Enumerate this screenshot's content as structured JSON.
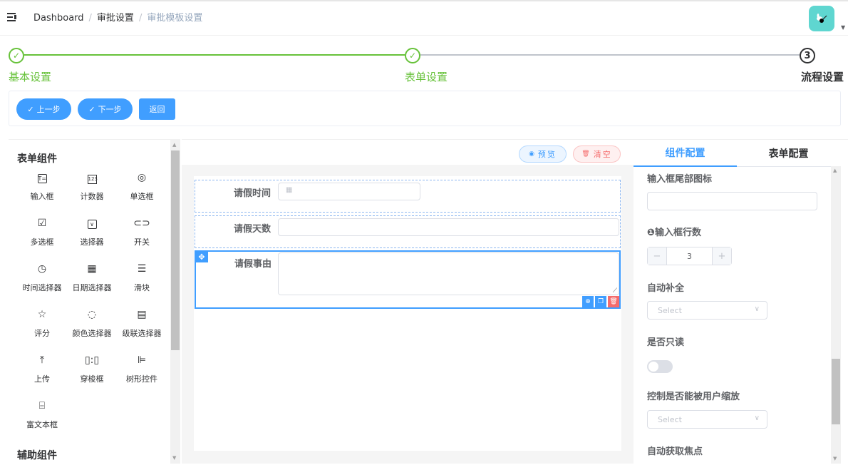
{
  "navbar": {
    "menu_icon": "hamburger-fold-icon",
    "breadcrumb": [
      "Dashboard",
      "审批设置",
      "审批模板设置"
    ],
    "breadcrumb_separator": "/",
    "avatar_icon": "user-avatar"
  },
  "steps": [
    {
      "index": "1",
      "title": "基本设置",
      "status": "done"
    },
    {
      "index": "2",
      "title": "表单设置",
      "status": "done"
    },
    {
      "index": "3",
      "title": "流程设置",
      "status": "current"
    }
  ],
  "actions": {
    "prev_label": "上一步",
    "next_label": "下一步",
    "back_label": "返回",
    "check_glyph": "✓"
  },
  "left_panel": {
    "form_components_title": "表单组件",
    "components": [
      {
        "label": "输入框",
        "icon": "T="
      },
      {
        "label": "计数器",
        "icon": "123"
      },
      {
        "label": "单选框",
        "icon": "◎"
      },
      {
        "label": "多选框",
        "icon": "☑"
      },
      {
        "label": "选择器",
        "icon": "⌵"
      },
      {
        "label": "开关",
        "icon": "⊙"
      },
      {
        "label": "时间选择器",
        "icon": "◷"
      },
      {
        "label": "日期选择器",
        "icon": "▦"
      },
      {
        "label": "滑块",
        "icon": "☰"
      },
      {
        "label": "评分",
        "icon": "☆"
      },
      {
        "label": "颜色选择器",
        "icon": "◌"
      },
      {
        "label": "级联选择器",
        "icon": "▤"
      },
      {
        "label": "上传",
        "icon": "⤒"
      },
      {
        "label": "穿梭框",
        "icon": "▯▯"
      },
      {
        "label": "树形控件",
        "icon": "⊫"
      },
      {
        "label": "富文本框",
        "icon": "⌸"
      }
    ],
    "aux_components_title": "辅助组件"
  },
  "canvas": {
    "preview_label": "预览",
    "clear_label": "清空",
    "fields": [
      {
        "label": "请假时间",
        "type": "date"
      },
      {
        "label": "请假天数",
        "type": "input"
      },
      {
        "label": "请假事由",
        "type": "textarea",
        "active": true
      }
    ]
  },
  "right_panel": {
    "tabs": [
      {
        "label": "组件配置",
        "active": true
      },
      {
        "label": "表单配置",
        "active": false
      }
    ],
    "config": {
      "suffix_icon_label": "输入框尾部图标",
      "suffix_icon_value": "",
      "rows_label": "输入框行数",
      "rows_info_glyph": "❶",
      "rows_value": "3",
      "minus": "−",
      "plus": "+",
      "autocomplete_label": "自动补全",
      "autocomplete_placeholder": "Select",
      "readonly_label": "是否只读",
      "readonly_value": false,
      "resize_label": "控制是否能被用户缩放",
      "resize_placeholder": "Select",
      "autofocus_label": "自动获取焦点"
    }
  },
  "colors": {
    "primary": "#409eff",
    "success": "#67c23a",
    "danger": "#f56c6c",
    "avatar_bg": "#5fd6d0"
  }
}
